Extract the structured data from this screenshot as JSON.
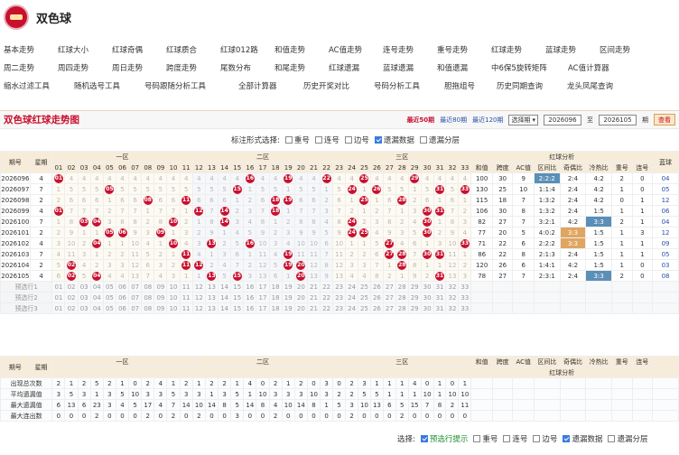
{
  "app": {
    "title": "双色球"
  },
  "nav": {
    "row1": [
      "基本走势",
      "红球大小",
      "红球奇偶",
      "红球质合",
      "红球012路",
      "和值走势",
      "AC值走势",
      "连号走势",
      "重号走势",
      "红球走势",
      "蓝球走势",
      "区间走势"
    ],
    "row2": [
      "周二走势",
      "周四走势",
      "周日走势",
      "跨度走势",
      "尾数分布",
      "和尾走势",
      "红球遗漏",
      "蓝球遗漏",
      "和值遗漏",
      "中6保5旋转矩阵",
      "AC值计算器"
    ],
    "row3": [
      "缩水过滤工具",
      "随机选号工具",
      "号码跟随分析工具",
      "全部计算器",
      "历史开奖对比",
      "号码分析工具",
      "胆拖组号",
      "历史同期查询",
      "龙头凤尾查询"
    ]
  },
  "panel": {
    "title": "双色球红球走势图",
    "links": [
      "最近50期",
      "最近80期",
      "最近120期"
    ],
    "period_select": "选择期",
    "from_period": "2026096",
    "to_label": "至",
    "to_period": "2026105",
    "period_suffix": "期",
    "view_button": "查看"
  },
  "options": {
    "label": "标注形式选择:",
    "items": [
      {
        "label": "重号",
        "checked": false
      },
      {
        "label": "连号",
        "checked": false
      },
      {
        "label": "边号",
        "checked": false
      },
      {
        "label": "遗漏数据",
        "checked": true
      },
      {
        "label": "遗漏分层",
        "checked": false
      }
    ]
  },
  "table": {
    "h_period": "期号",
    "h_weekday": "星期",
    "zones": [
      "一区",
      "二区",
      "三区"
    ],
    "h_analysis": "红球分析",
    "h_blue": "蓝球",
    "analysis_cols": [
      "和值",
      "跨度",
      "AC值",
      "区间比",
      "奇偶比",
      "冷热比",
      "重号",
      "连号"
    ],
    "rows": [
      {
        "p": "2026096",
        "w": "4",
        "balls": [
          1,
          16,
          19,
          22,
          25,
          29
        ],
        "sum": "100",
        "span": "30",
        "ac": "9",
        "zone": "2:2:2",
        "odd": "2:4",
        "hot": "4:2",
        "rep": "2",
        "cons": "0",
        "blue": "04"
      },
      {
        "p": "2026097",
        "w": "7",
        "balls": [
          5,
          15,
          24,
          26,
          31,
          33
        ],
        "sum": "130",
        "span": "25",
        "ac": "10",
        "zone": "1:1:4",
        "odd": "2:4",
        "hot": "4:2",
        "rep": "1",
        "cons": "0",
        "blue": "05"
      },
      {
        "p": "2026098",
        "w": "2",
        "balls": [
          8,
          11,
          18,
          19,
          25,
          28
        ],
        "sum": "115",
        "span": "18",
        "ac": "7",
        "zone": "1:3:2",
        "odd": "2:4",
        "hot": "4:2",
        "rep": "0",
        "cons": "1",
        "blue": "12"
      },
      {
        "p": "2026099",
        "w": "4",
        "balls": [
          1,
          12,
          14,
          18,
          30,
          31
        ],
        "sum": "106",
        "span": "30",
        "ac": "8",
        "zone": "1:3:2",
        "odd": "2:4",
        "hot": "1:5",
        "rep": "1",
        "cons": "1",
        "blue": "06"
      },
      {
        "p": "2026100",
        "w": "7",
        "balls": [
          3,
          4,
          10,
          14,
          24,
          30
        ],
        "sum": "82",
        "span": "27",
        "ac": "7",
        "zone": "3:2:1",
        "odd": "4:2",
        "hot": "3:3",
        "rep": "2",
        "cons": "1",
        "blue": "04"
      },
      {
        "p": "2026101",
        "w": "2",
        "balls": [
          5,
          6,
          9,
          24,
          25,
          30
        ],
        "sum": "77",
        "span": "20",
        "ac": "5",
        "zone": "4:0:2",
        "odd": "3:3",
        "hot": "1:5",
        "rep": "1",
        "cons": "3",
        "blue": "12"
      },
      {
        "p": "2026102",
        "w": "4",
        "balls": [
          4,
          10,
          13,
          16,
          27,
          33
        ],
        "sum": "71",
        "span": "22",
        "ac": "6",
        "zone": "2:2:2",
        "odd": "3:3",
        "hot": "1:5",
        "rep": "1",
        "cons": "1",
        "blue": "09"
      },
      {
        "p": "2026103",
        "w": "7",
        "balls": [
          11,
          19,
          27,
          28,
          30,
          31
        ],
        "sum": "86",
        "span": "22",
        "ac": "8",
        "zone": "2:1:3",
        "odd": "2:4",
        "hot": "1:5",
        "rep": "1",
        "cons": "1",
        "blue": "05"
      },
      {
        "p": "2026104",
        "w": "2",
        "balls": [
          2,
          11,
          12,
          19,
          20,
          28
        ],
        "sum": "120",
        "span": "26",
        "ac": "6",
        "zone": "1:4:1",
        "odd": "4:2",
        "hot": "1:5",
        "rep": "1",
        "cons": "0",
        "blue": "03"
      },
      {
        "p": "2026105",
        "w": "4",
        "balls": [
          2,
          4,
          13,
          15,
          20,
          31
        ],
        "sum": "78",
        "span": "27",
        "ac": "7",
        "zone": "2:3:1",
        "odd": "2:4",
        "hot": "3:3",
        "rep": "2",
        "cons": "0",
        "blue": "08"
      }
    ],
    "pre_rows": [
      "预选行1",
      "预选行2",
      "预选行3"
    ],
    "h_period2": "期号",
    "h_weekday2": "星期",
    "stats": [
      {
        "label": "出现总次数",
        "v": [
          "2",
          "1",
          "2",
          "5",
          "2",
          "1",
          "0",
          "2",
          "4",
          "1",
          "2",
          "1",
          "2",
          "2",
          "1",
          "4",
          "0",
          "2",
          "1",
          "2",
          "0",
          "3",
          "0",
          "2",
          "3",
          "1",
          "1",
          "1",
          "4",
          "0",
          "1",
          "0",
          "1"
        ]
      },
      {
        "label": "平均遗漏值",
        "v": [
          "3",
          "5",
          "3",
          "1",
          "3",
          "5",
          "10",
          "3",
          "3",
          "5",
          "3",
          "3",
          "1",
          "3",
          "5",
          "1",
          "10",
          "3",
          "3",
          "3",
          "10",
          "3",
          "2",
          "2",
          "5",
          "5",
          "1",
          "1",
          "1",
          "10",
          "1",
          "10",
          "10"
        ]
      },
      {
        "label": "最大遗漏值",
        "v": [
          "6",
          "13",
          "6",
          "23",
          "3",
          "4",
          "5",
          "17",
          "4",
          "7",
          "14",
          "10",
          "14",
          "8",
          "5",
          "14",
          "8",
          "4",
          "10",
          "14",
          "8",
          "1",
          "5",
          "3",
          "10",
          "13",
          "6",
          "5",
          "15",
          "7",
          "8",
          "2",
          "11"
        ]
      },
      {
        "label": "最大连出数",
        "v": [
          "0",
          "0",
          "0",
          "2",
          "0",
          "0",
          "0",
          "2",
          "0",
          "2",
          "0",
          "2",
          "0",
          "0",
          "3",
          "0",
          "0",
          "2",
          "0",
          "0",
          "0",
          "0",
          "0",
          "2",
          "0",
          "0",
          "0",
          "2",
          "0",
          "0",
          "0",
          "0",
          "0"
        ]
      }
    ]
  },
  "footer": {
    "label": "选择:",
    "items": [
      {
        "label": "预选行提示",
        "checked": true
      },
      {
        "label": "重号",
        "checked": false
      },
      {
        "label": "连号",
        "checked": false
      },
      {
        "label": "边号",
        "checked": false
      },
      {
        "label": "遗漏数据",
        "checked": true
      },
      {
        "label": "遗漏分层",
        "checked": false
      }
    ]
  },
  "colors": {
    "red": "#c8102e",
    "blue": "#2a4fa8",
    "header_bg": "#f7ecd9"
  }
}
